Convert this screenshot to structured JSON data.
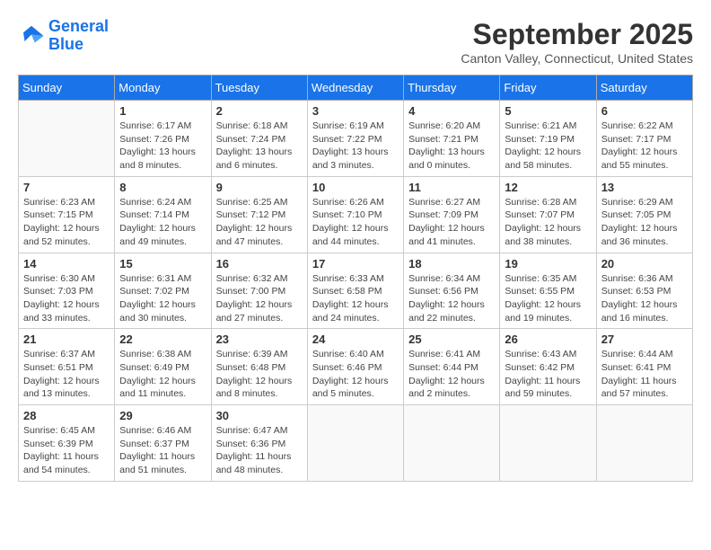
{
  "logo": {
    "line1": "General",
    "line2": "Blue"
  },
  "title": "September 2025",
  "subtitle": "Canton Valley, Connecticut, United States",
  "days_of_week": [
    "Sunday",
    "Monday",
    "Tuesday",
    "Wednesday",
    "Thursday",
    "Friday",
    "Saturday"
  ],
  "weeks": [
    [
      {
        "day": "",
        "info": ""
      },
      {
        "day": "1",
        "info": "Sunrise: 6:17 AM\nSunset: 7:26 PM\nDaylight: 13 hours\nand 8 minutes."
      },
      {
        "day": "2",
        "info": "Sunrise: 6:18 AM\nSunset: 7:24 PM\nDaylight: 13 hours\nand 6 minutes."
      },
      {
        "day": "3",
        "info": "Sunrise: 6:19 AM\nSunset: 7:22 PM\nDaylight: 13 hours\nand 3 minutes."
      },
      {
        "day": "4",
        "info": "Sunrise: 6:20 AM\nSunset: 7:21 PM\nDaylight: 13 hours\nand 0 minutes."
      },
      {
        "day": "5",
        "info": "Sunrise: 6:21 AM\nSunset: 7:19 PM\nDaylight: 12 hours\nand 58 minutes."
      },
      {
        "day": "6",
        "info": "Sunrise: 6:22 AM\nSunset: 7:17 PM\nDaylight: 12 hours\nand 55 minutes."
      }
    ],
    [
      {
        "day": "7",
        "info": "Sunrise: 6:23 AM\nSunset: 7:15 PM\nDaylight: 12 hours\nand 52 minutes."
      },
      {
        "day": "8",
        "info": "Sunrise: 6:24 AM\nSunset: 7:14 PM\nDaylight: 12 hours\nand 49 minutes."
      },
      {
        "day": "9",
        "info": "Sunrise: 6:25 AM\nSunset: 7:12 PM\nDaylight: 12 hours\nand 47 minutes."
      },
      {
        "day": "10",
        "info": "Sunrise: 6:26 AM\nSunset: 7:10 PM\nDaylight: 12 hours\nand 44 minutes."
      },
      {
        "day": "11",
        "info": "Sunrise: 6:27 AM\nSunset: 7:09 PM\nDaylight: 12 hours\nand 41 minutes."
      },
      {
        "day": "12",
        "info": "Sunrise: 6:28 AM\nSunset: 7:07 PM\nDaylight: 12 hours\nand 38 minutes."
      },
      {
        "day": "13",
        "info": "Sunrise: 6:29 AM\nSunset: 7:05 PM\nDaylight: 12 hours\nand 36 minutes."
      }
    ],
    [
      {
        "day": "14",
        "info": "Sunrise: 6:30 AM\nSunset: 7:03 PM\nDaylight: 12 hours\nand 33 minutes."
      },
      {
        "day": "15",
        "info": "Sunrise: 6:31 AM\nSunset: 7:02 PM\nDaylight: 12 hours\nand 30 minutes."
      },
      {
        "day": "16",
        "info": "Sunrise: 6:32 AM\nSunset: 7:00 PM\nDaylight: 12 hours\nand 27 minutes."
      },
      {
        "day": "17",
        "info": "Sunrise: 6:33 AM\nSunset: 6:58 PM\nDaylight: 12 hours\nand 24 minutes."
      },
      {
        "day": "18",
        "info": "Sunrise: 6:34 AM\nSunset: 6:56 PM\nDaylight: 12 hours\nand 22 minutes."
      },
      {
        "day": "19",
        "info": "Sunrise: 6:35 AM\nSunset: 6:55 PM\nDaylight: 12 hours\nand 19 minutes."
      },
      {
        "day": "20",
        "info": "Sunrise: 6:36 AM\nSunset: 6:53 PM\nDaylight: 12 hours\nand 16 minutes."
      }
    ],
    [
      {
        "day": "21",
        "info": "Sunrise: 6:37 AM\nSunset: 6:51 PM\nDaylight: 12 hours\nand 13 minutes."
      },
      {
        "day": "22",
        "info": "Sunrise: 6:38 AM\nSunset: 6:49 PM\nDaylight: 12 hours\nand 11 minutes."
      },
      {
        "day": "23",
        "info": "Sunrise: 6:39 AM\nSunset: 6:48 PM\nDaylight: 12 hours\nand 8 minutes."
      },
      {
        "day": "24",
        "info": "Sunrise: 6:40 AM\nSunset: 6:46 PM\nDaylight: 12 hours\nand 5 minutes."
      },
      {
        "day": "25",
        "info": "Sunrise: 6:41 AM\nSunset: 6:44 PM\nDaylight: 12 hours\nand 2 minutes."
      },
      {
        "day": "26",
        "info": "Sunrise: 6:43 AM\nSunset: 6:42 PM\nDaylight: 11 hours\nand 59 minutes."
      },
      {
        "day": "27",
        "info": "Sunrise: 6:44 AM\nSunset: 6:41 PM\nDaylight: 11 hours\nand 57 minutes."
      }
    ],
    [
      {
        "day": "28",
        "info": "Sunrise: 6:45 AM\nSunset: 6:39 PM\nDaylight: 11 hours\nand 54 minutes."
      },
      {
        "day": "29",
        "info": "Sunrise: 6:46 AM\nSunset: 6:37 PM\nDaylight: 11 hours\nand 51 minutes."
      },
      {
        "day": "30",
        "info": "Sunrise: 6:47 AM\nSunset: 6:36 PM\nDaylight: 11 hours\nand 48 minutes."
      },
      {
        "day": "",
        "info": ""
      },
      {
        "day": "",
        "info": ""
      },
      {
        "day": "",
        "info": ""
      },
      {
        "day": "",
        "info": ""
      }
    ]
  ]
}
